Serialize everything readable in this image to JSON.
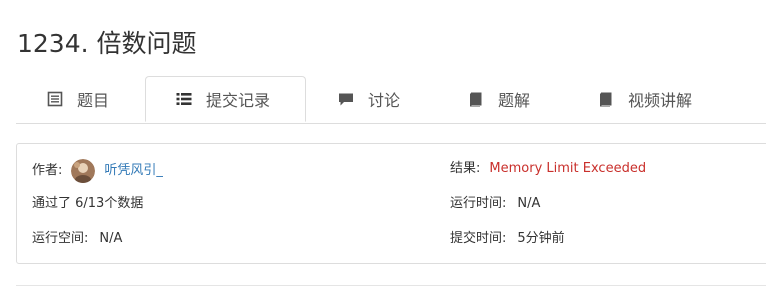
{
  "problem": {
    "title": "1234. 倍数问题"
  },
  "tabs": [
    {
      "label": "题目",
      "icon": "document-icon",
      "active": false
    },
    {
      "label": "提交记录",
      "icon": "list-icon",
      "active": true
    },
    {
      "label": "讨论",
      "icon": "comment-icon",
      "active": false
    },
    {
      "label": "题解",
      "icon": "book-icon",
      "active": false
    },
    {
      "label": "视频讲解",
      "icon": "book-icon",
      "active": false
    }
  ],
  "submission": {
    "author_label": "作者:",
    "author_name": "听凭风引_",
    "result_label": "结果:",
    "result_value": "Memory Limit Exceeded",
    "passed_text": "通过了 6/13个数据",
    "run_time_label": "运行时间:",
    "run_time_value": "N/A",
    "run_space_label": "运行空间:",
    "run_space_value": "N/A",
    "submit_time_label": "提交时间:",
    "submit_time_value": "5分钟前"
  },
  "colors": {
    "result_error": "#c9302c",
    "link": "#337ab7",
    "border": "#dddddd"
  }
}
